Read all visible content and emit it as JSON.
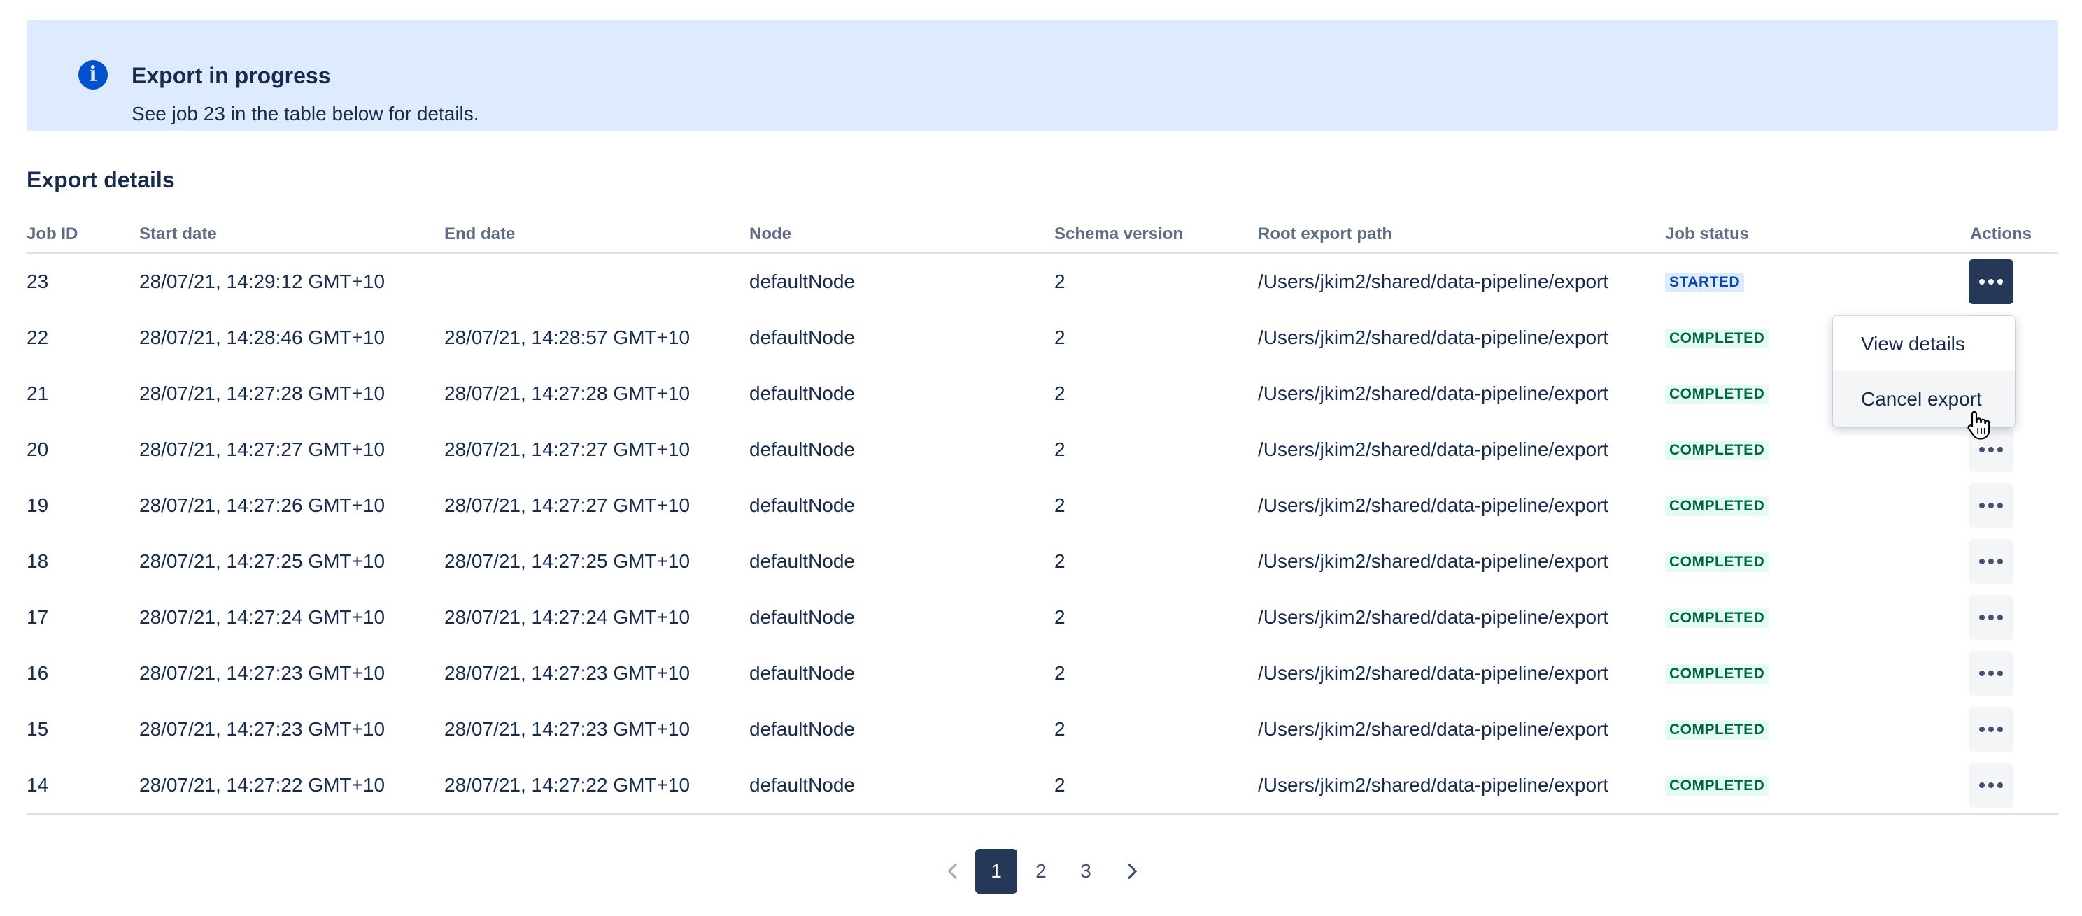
{
  "banner": {
    "icon": "info-icon",
    "icon_glyph": "i",
    "title": "Export in progress",
    "text": "See job 23 in the table below for details.",
    "background": "#deebff",
    "icon_color": "#0052cc"
  },
  "section_title": "Export details",
  "table": {
    "columns": {
      "job_id": "Job ID",
      "start_date": "Start date",
      "end_date": "End date",
      "node": "Node",
      "schema_version": "Schema version",
      "root_export_path": "Root export path",
      "job_status": "Job status",
      "actions": "Actions"
    },
    "rows": [
      {
        "job_id": "23",
        "start": "28/07/21, 14:29:12 GMT+10",
        "end": "",
        "node": "defaultNode",
        "schema": "2",
        "path": "/Users/jkim2/shared/data-pipeline/export",
        "status": "STARTED"
      },
      {
        "job_id": "22",
        "start": "28/07/21, 14:28:46 GMT+10",
        "end": "28/07/21, 14:28:57 GMT+10",
        "node": "defaultNode",
        "schema": "2",
        "path": "/Users/jkim2/shared/data-pipeline/export",
        "status": "COMPLETED"
      },
      {
        "job_id": "21",
        "start": "28/07/21, 14:27:28 GMT+10",
        "end": "28/07/21, 14:27:28 GMT+10",
        "node": "defaultNode",
        "schema": "2",
        "path": "/Users/jkim2/shared/data-pipeline/export",
        "status": "COMPLETED"
      },
      {
        "job_id": "20",
        "start": "28/07/21, 14:27:27 GMT+10",
        "end": "28/07/21, 14:27:27 GMT+10",
        "node": "defaultNode",
        "schema": "2",
        "path": "/Users/jkim2/shared/data-pipeline/export",
        "status": "COMPLETED"
      },
      {
        "job_id": "19",
        "start": "28/07/21, 14:27:26 GMT+10",
        "end": "28/07/21, 14:27:27 GMT+10",
        "node": "defaultNode",
        "schema": "2",
        "path": "/Users/jkim2/shared/data-pipeline/export",
        "status": "COMPLETED"
      },
      {
        "job_id": "18",
        "start": "28/07/21, 14:27:25 GMT+10",
        "end": "28/07/21, 14:27:25 GMT+10",
        "node": "defaultNode",
        "schema": "2",
        "path": "/Users/jkim2/shared/data-pipeline/export",
        "status": "COMPLETED"
      },
      {
        "job_id": "17",
        "start": "28/07/21, 14:27:24 GMT+10",
        "end": "28/07/21, 14:27:24 GMT+10",
        "node": "defaultNode",
        "schema": "2",
        "path": "/Users/jkim2/shared/data-pipeline/export",
        "status": "COMPLETED"
      },
      {
        "job_id": "16",
        "start": "28/07/21, 14:27:23 GMT+10",
        "end": "28/07/21, 14:27:23 GMT+10",
        "node": "defaultNode",
        "schema": "2",
        "path": "/Users/jkim2/shared/data-pipeline/export",
        "status": "COMPLETED"
      },
      {
        "job_id": "15",
        "start": "28/07/21, 14:27:23 GMT+10",
        "end": "28/07/21, 14:27:23 GMT+10",
        "node": "defaultNode",
        "schema": "2",
        "path": "/Users/jkim2/shared/data-pipeline/export",
        "status": "COMPLETED"
      },
      {
        "job_id": "14",
        "start": "28/07/21, 14:27:22 GMT+10",
        "end": "28/07/21, 14:27:22 GMT+10",
        "node": "defaultNode",
        "schema": "2",
        "path": "/Users/jkim2/shared/data-pipeline/export",
        "status": "COMPLETED"
      }
    ],
    "row_action_icon": "more-horizontal-icon",
    "active_row_index": 0
  },
  "action_menu": {
    "items": [
      {
        "label": "View details"
      },
      {
        "label": "Cancel export"
      }
    ],
    "hovered_index": 1
  },
  "pagination": {
    "prev_icon": "chevron-left-icon",
    "next_icon": "chevron-right-icon",
    "pages": [
      "1",
      "2",
      "3"
    ],
    "current": "1"
  },
  "colors": {
    "text_primary": "#172b4d",
    "text_subtle": "#5e6c84",
    "active_dark": "#253858",
    "started_bg": "#deebff",
    "started_fg": "#0747a6",
    "completed_bg": "#e3fcef",
    "completed_fg": "#006644"
  }
}
